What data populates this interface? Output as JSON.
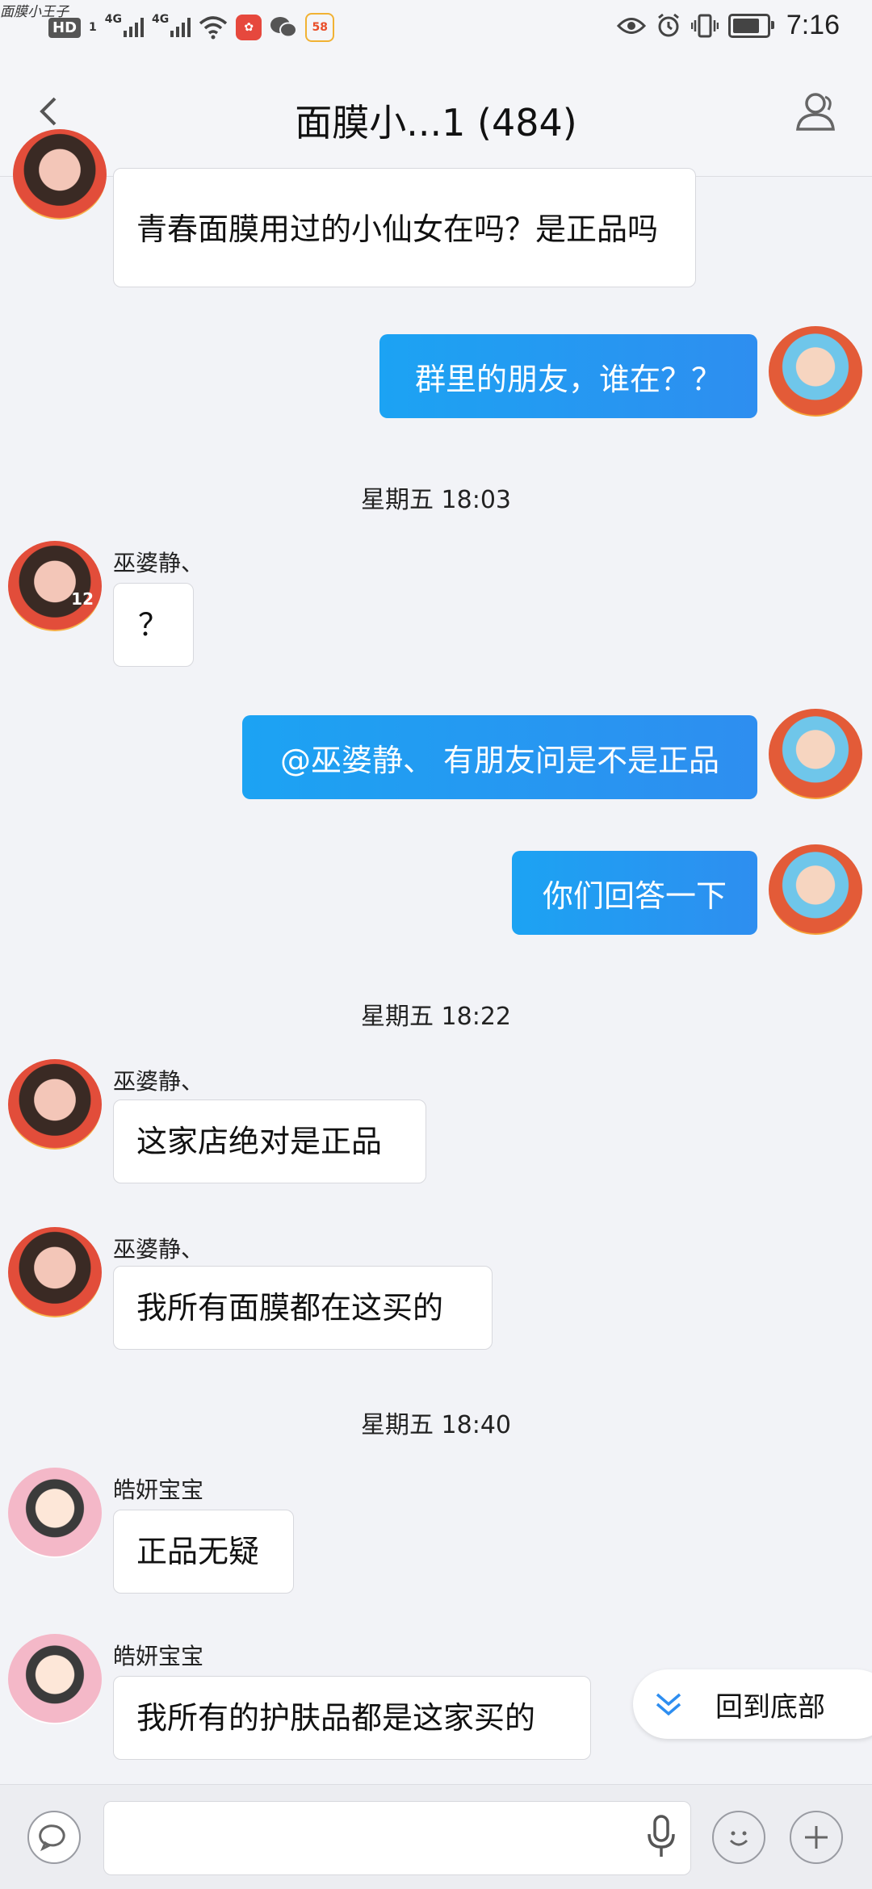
{
  "status_bar": {
    "watermark": "面膜小王子",
    "hd": "HD",
    "sim_slot": "1",
    "net1": "4G",
    "net2": "4G",
    "app_badge": "58",
    "time": "7:16",
    "battery_level": 0.8
  },
  "header": {
    "title": "面膜小...1 (484)"
  },
  "messages": [
    {
      "kind": "in",
      "text": "青春面膜用过的小仙女在吗？是正品吗"
    },
    {
      "kind": "out",
      "text": "群里的朋友，谁在？？"
    },
    {
      "kind": "timestamp",
      "text": "星期五 18:03"
    },
    {
      "kind": "in",
      "sender": "巫婆静、",
      "text": "？"
    },
    {
      "kind": "out",
      "text": "@巫婆静、 有朋友问是不是正品"
    },
    {
      "kind": "out",
      "text": "你们回答一下"
    },
    {
      "kind": "timestamp",
      "text": "星期五 18:22"
    },
    {
      "kind": "in",
      "sender": "巫婆静、",
      "text": "这家店绝对是正品"
    },
    {
      "kind": "in",
      "sender": "巫婆静、",
      "text": "我所有面膜都在这买的"
    },
    {
      "kind": "timestamp",
      "text": "星期五 18:40"
    },
    {
      "kind": "in",
      "sender": "皓妍宝宝",
      "text": "正品无疑"
    },
    {
      "kind": "in",
      "sender": "皓妍宝宝",
      "text": "我所有的护肤品都是这家买的"
    }
  ],
  "return_to_bottom": {
    "label": "回到底部"
  },
  "input": {
    "placeholder": ""
  },
  "avatar_levels": {
    "jing": "12"
  },
  "colors": {
    "outgoing_bubble": "#1ca3f3",
    "background": "#f2f3f7"
  }
}
